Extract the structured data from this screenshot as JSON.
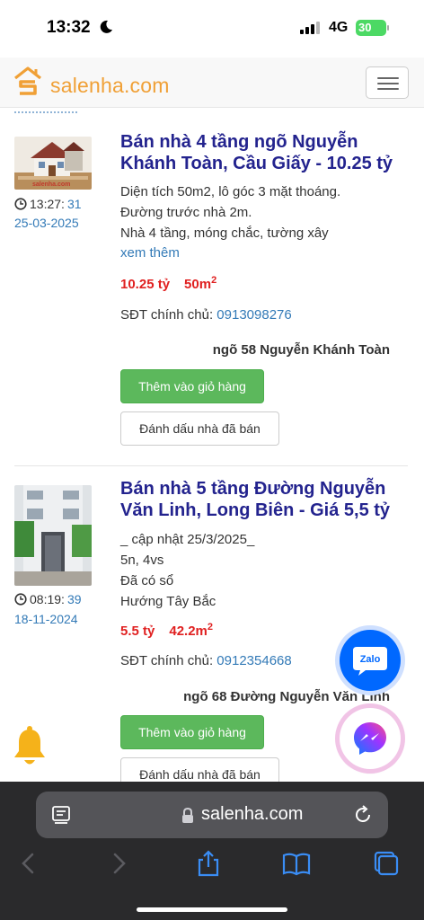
{
  "status": {
    "time": "13:32",
    "network": "4G",
    "battery": "30"
  },
  "site": {
    "logo_text": "salenha.com",
    "brand_color": "#f0a036"
  },
  "listings": [
    {
      "title": "Bán nhà 4 tầng ngõ Nguyễn Khánh Toàn, Cầu Giấy - 10.25 tỷ",
      "time_hm": "13:27:",
      "time_s": "31",
      "date": "25-03-2025",
      "thumb_caption": "salenha.com",
      "desc": [
        "Diện tích 50m2, lô góc 3 mặt thoáng.",
        "Đường trước nhà 2m.",
        "Nhà 4 tầng, móng chắc, tường xây"
      ],
      "more": "xem thêm",
      "price": "10.25 tỷ",
      "area": "50m",
      "area_sup": "2",
      "phone_label": "SĐT chính chủ:",
      "phone": "0913098276",
      "address": "ngõ 58 Nguyễn Khánh Toàn",
      "cart_label": "Thêm vào giỏ hàng",
      "sold_label": "Đánh dấu nhà đã bán"
    },
    {
      "title": "Bán nhà 5 tầng Đường Nguyễn Văn Linh, Long Biên - Giá 5,5 tỷ",
      "time_hm": "08:19:",
      "time_s": "39",
      "date": "18-11-2024",
      "desc": [
        "_ cập nhật 25/3/2025_",
        "5n, 4vs",
        "Đã có sổ",
        "Hướng Tây Bắc"
      ],
      "price": "5.5 tỷ",
      "area": "42.2m",
      "area_sup": "2",
      "phone_label": "SĐT chính chủ:",
      "phone": "0912354668",
      "address": "ngõ 68 Đường Nguyễn Văn Linh",
      "cart_label": "Thêm vào giỏ hàng",
      "sold_label": "Đánh dấu nhà đã bán"
    }
  ],
  "floating": {
    "zalo_label": "Zalo"
  },
  "safari": {
    "url": "salenha.com"
  }
}
